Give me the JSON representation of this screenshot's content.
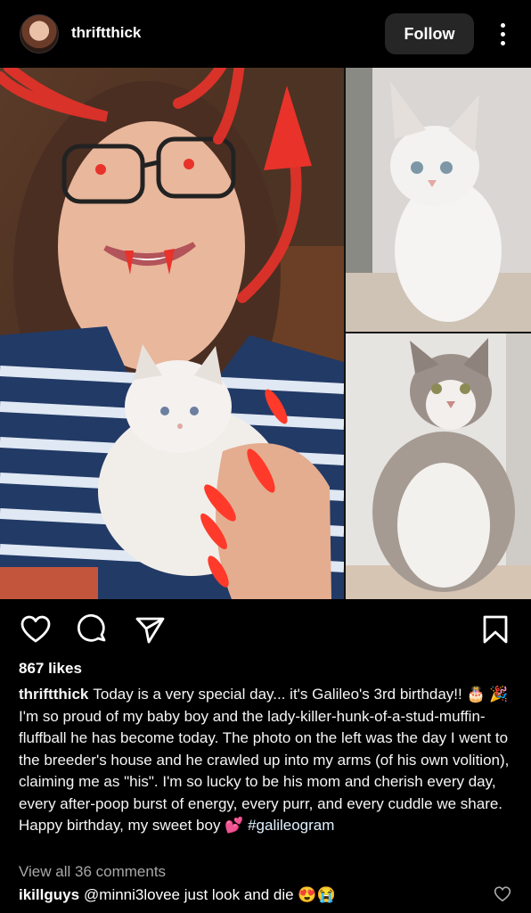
{
  "header": {
    "username": "thriftthick",
    "follow_label": "Follow"
  },
  "icons": {
    "like": "heart-icon",
    "comment": "comment-icon",
    "share": "send-icon",
    "save": "bookmark-icon",
    "more": "more-vertical-icon"
  },
  "post": {
    "likes": "867 likes",
    "caption_user": "thriftthick",
    "caption_text_1": "Today is a very special day... it's Galileo's 3rd birthday!! 🎂 🎉 I'm so proud of my baby boy and the lady-killer-hunk-of-a-stud-muffin-fluffball he has become today. The photo on the left was the day I went to the breeder's house and he crawled up into my arms (of his own volition), claiming me as \"his\". I'm so lucky to be his mom and cherish every day, every after-poop burst of energy, every purr, and every cuddle we share. Happy birthday, my sweet boy 💕",
    "caption_hashtag": "#galileogram",
    "view_comments": "View all 36 comments",
    "comment_user": "ikillguys",
    "comment_text": "@minni3lovee just look and die 😍😭"
  },
  "colors": {
    "background": "#000000",
    "follow_bg": "#262626",
    "muted_text": "#a8a8a8",
    "drawing_red": "#e8322a"
  }
}
